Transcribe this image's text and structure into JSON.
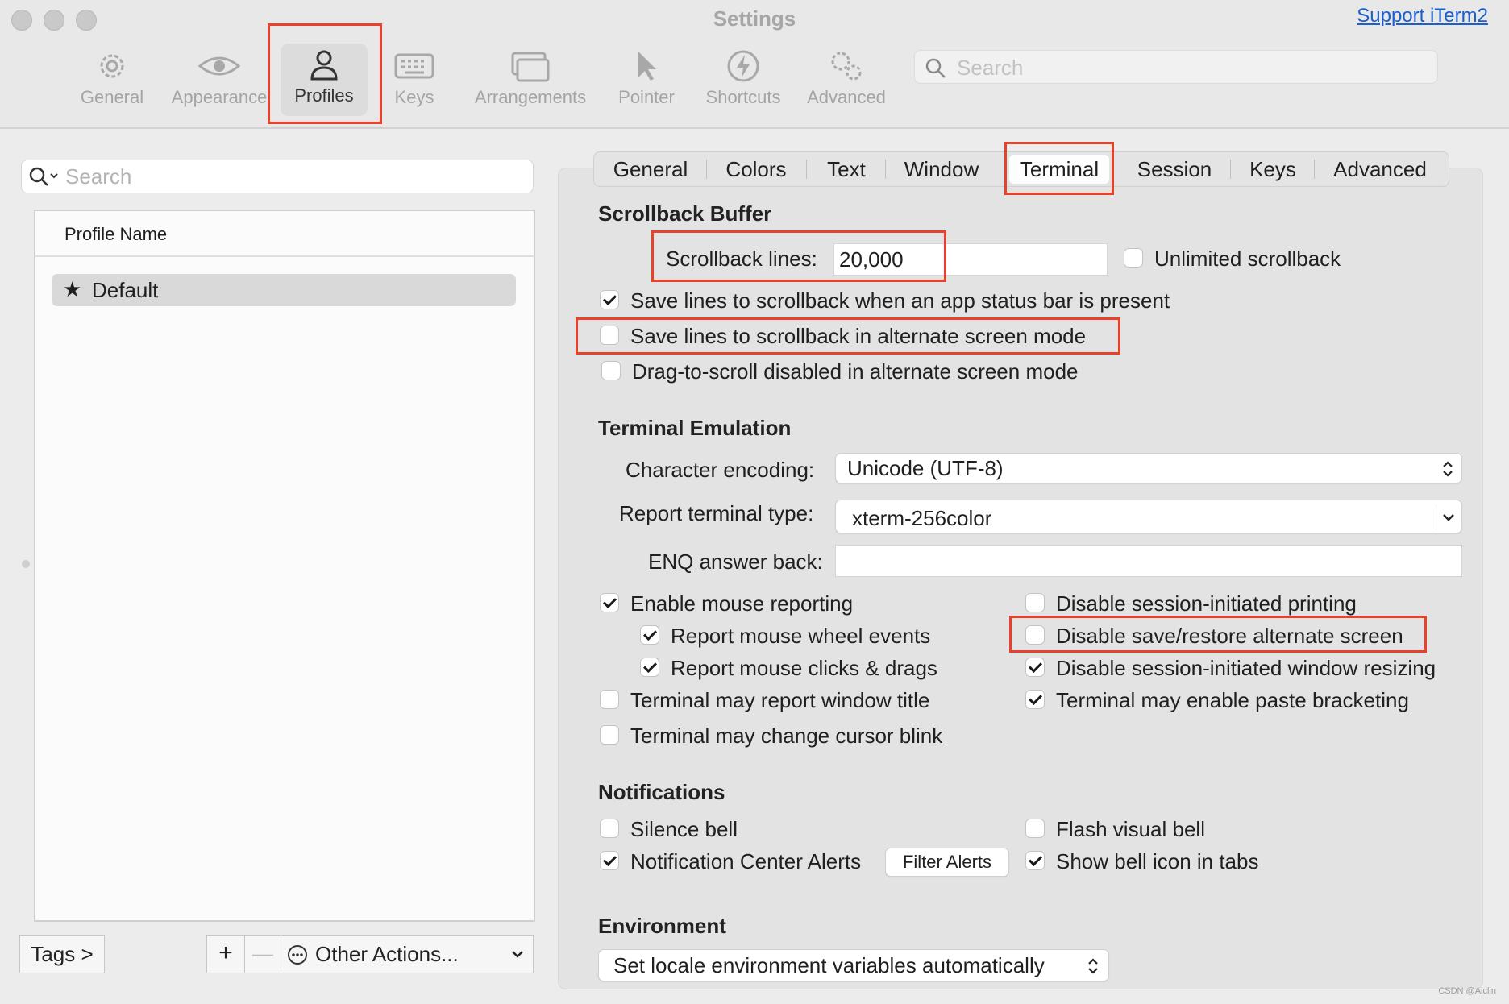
{
  "window": {
    "title": "Settings",
    "support_link": "Support iTerm2"
  },
  "toolbar": {
    "items": [
      {
        "label": "General",
        "icon": "gear-icon"
      },
      {
        "label": "Appearance",
        "icon": "eye-icon"
      },
      {
        "label": "Profiles",
        "icon": "person-icon",
        "selected": true
      },
      {
        "label": "Keys",
        "icon": "keyboard-icon"
      },
      {
        "label": "Arrangements",
        "icon": "windows-icon"
      },
      {
        "label": "Pointer",
        "icon": "pointer-icon"
      },
      {
        "label": "Shortcuts",
        "icon": "lightning-icon"
      },
      {
        "label": "Advanced",
        "icon": "gears-icon"
      }
    ],
    "search_placeholder": "Search"
  },
  "profiles": {
    "search_placeholder": "Search",
    "column_header": "Profile Name",
    "rows": [
      {
        "name": "Default",
        "default": true
      }
    ],
    "tags_button": "Tags >",
    "add_button": "+",
    "remove_button": "—",
    "other_actions": "Other Actions..."
  },
  "tabs": [
    "General",
    "Colors",
    "Text",
    "Window",
    "Terminal",
    "Session",
    "Keys",
    "Advanced"
  ],
  "selected_tab": "Terminal",
  "scrollback": {
    "title": "Scrollback Buffer",
    "lines_label": "Scrollback lines:",
    "lines_value": "20,000",
    "unlimited_label": "Unlimited scrollback",
    "unlimited_checked": false,
    "save_status_bar_label": "Save lines to scrollback when an app status bar is present",
    "save_status_bar_checked": true,
    "save_alt_screen_label": "Save lines to scrollback in alternate screen mode",
    "save_alt_screen_checked": false,
    "drag_scroll_label": "Drag-to-scroll disabled in alternate screen mode",
    "drag_scroll_checked": false
  },
  "emulation": {
    "title": "Terminal Emulation",
    "encoding_label": "Character encoding:",
    "encoding_value": "Unicode (UTF-8)",
    "terminal_type_label": "Report terminal type:",
    "terminal_type_value": "xterm-256color",
    "enq_label": "ENQ answer back:",
    "enq_value": "",
    "options_left": [
      {
        "label": "Enable mouse reporting",
        "checked": true
      },
      {
        "label": "Report mouse wheel events",
        "checked": true
      },
      {
        "label": "Report mouse clicks & drags",
        "checked": true
      },
      {
        "label": "Terminal may report window title",
        "checked": false
      },
      {
        "label": "Terminal may change cursor blink",
        "checked": false
      }
    ],
    "options_right": [
      {
        "label": "Disable session-initiated printing",
        "checked": false
      },
      {
        "label": "Disable save/restore alternate screen",
        "checked": false
      },
      {
        "label": "Disable session-initiated window resizing",
        "checked": true
      },
      {
        "label": "Terminal may enable paste bracketing",
        "checked": true
      }
    ]
  },
  "notifications": {
    "title": "Notifications",
    "silence_bell": "Silence bell",
    "silence_bell_checked": false,
    "flash_bell": "Flash visual bell",
    "flash_bell_checked": false,
    "nc_alerts": "Notification Center Alerts",
    "nc_alerts_checked": true,
    "filter_alerts": "Filter Alerts",
    "bell_icon": "Show bell icon in tabs",
    "bell_icon_checked": true
  },
  "environment": {
    "title": "Environment",
    "locale_value": "Set locale environment variables automatically"
  },
  "watermark": "CSDN @Aiclin",
  "colors": {
    "highlight_red": "#e8412c",
    "link_blue": "#1a5fd0"
  }
}
